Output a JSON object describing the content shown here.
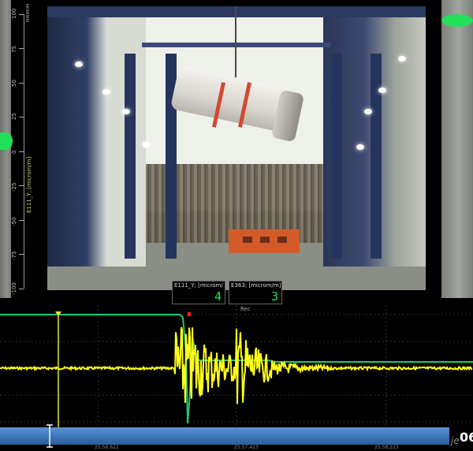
{
  "scale": {
    "title": "E111_Y; [microm/m]",
    "top_text": "MINIMUM",
    "ticks": [
      "100",
      "75",
      "50",
      "25",
      "0",
      "-25",
      "-50",
      "-75",
      "-100"
    ]
  },
  "readouts": [
    {
      "label": "E111_Y; [microm/",
      "value": "4"
    },
    {
      "label": "E363; [microm/m]",
      "value": "3"
    }
  ],
  "plot": {
    "rec_label": "Rec",
    "time_labels": [
      "25:56.622",
      "25:57.423",
      "25:58.223"
    ],
    "series_colors": {
      "signal": "#ffff1a",
      "reference": "#1fc96a",
      "cursor": "#e8e830",
      "marker": "#ff2a2a"
    }
  },
  "right_number": "06",
  "watermark_text": "je"
}
